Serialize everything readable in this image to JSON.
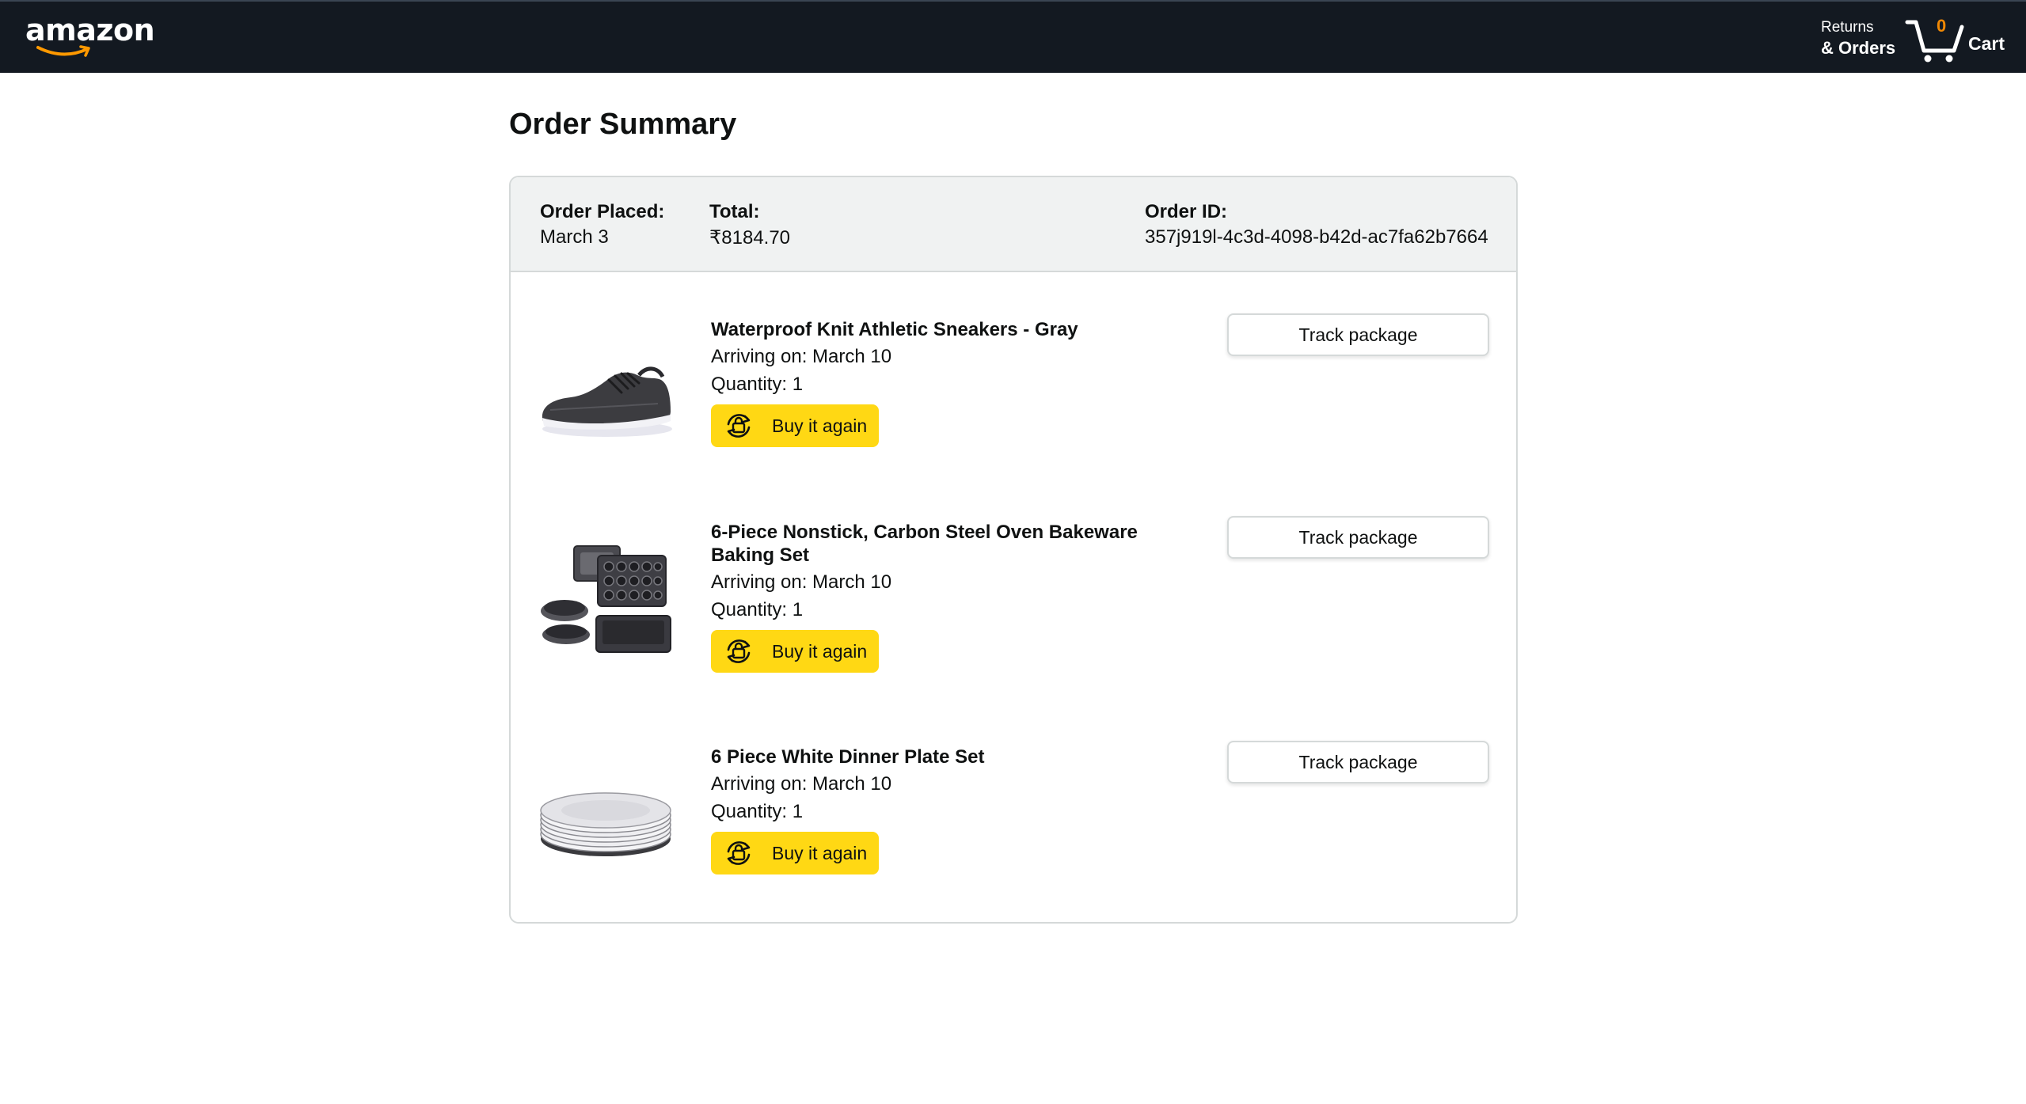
{
  "header": {
    "logo_text": "amazon",
    "returns_line1": "Returns",
    "returns_line2": "& Orders",
    "cart_count": "0",
    "cart_label": "Cart"
  },
  "page_title": "Order Summary",
  "order": {
    "placed_label": "Order Placed:",
    "placed_value": "March 3",
    "total_label": "Total:",
    "total_value": "₹8184.70",
    "id_label": "Order ID:",
    "id_value": "357j919l-4c3d-4098-b42d-ac7fa62b7664"
  },
  "items": [
    {
      "name": "Waterproof Knit Athletic Sneakers - Gray",
      "arriving": "Arriving on: March 10",
      "quantity": "Quantity: 1",
      "buy_again": "Buy it again",
      "track": "Track package"
    },
    {
      "name": "6-Piece Nonstick, Carbon Steel Oven Bakeware Baking Set",
      "arriving": "Arriving on: March 10",
      "quantity": "Quantity: 1",
      "buy_again": "Buy it again",
      "track": "Track package"
    },
    {
      "name": "6 Piece White Dinner Plate Set",
      "arriving": "Arriving on: March 10",
      "quantity": "Quantity: 1",
      "buy_again": "Buy it again",
      "track": "Track package"
    }
  ],
  "colors": {
    "header_bg": "#131921",
    "buy_button": "#ffd814",
    "cart_count": "#f08804",
    "logo_smile": "#ff9900"
  }
}
